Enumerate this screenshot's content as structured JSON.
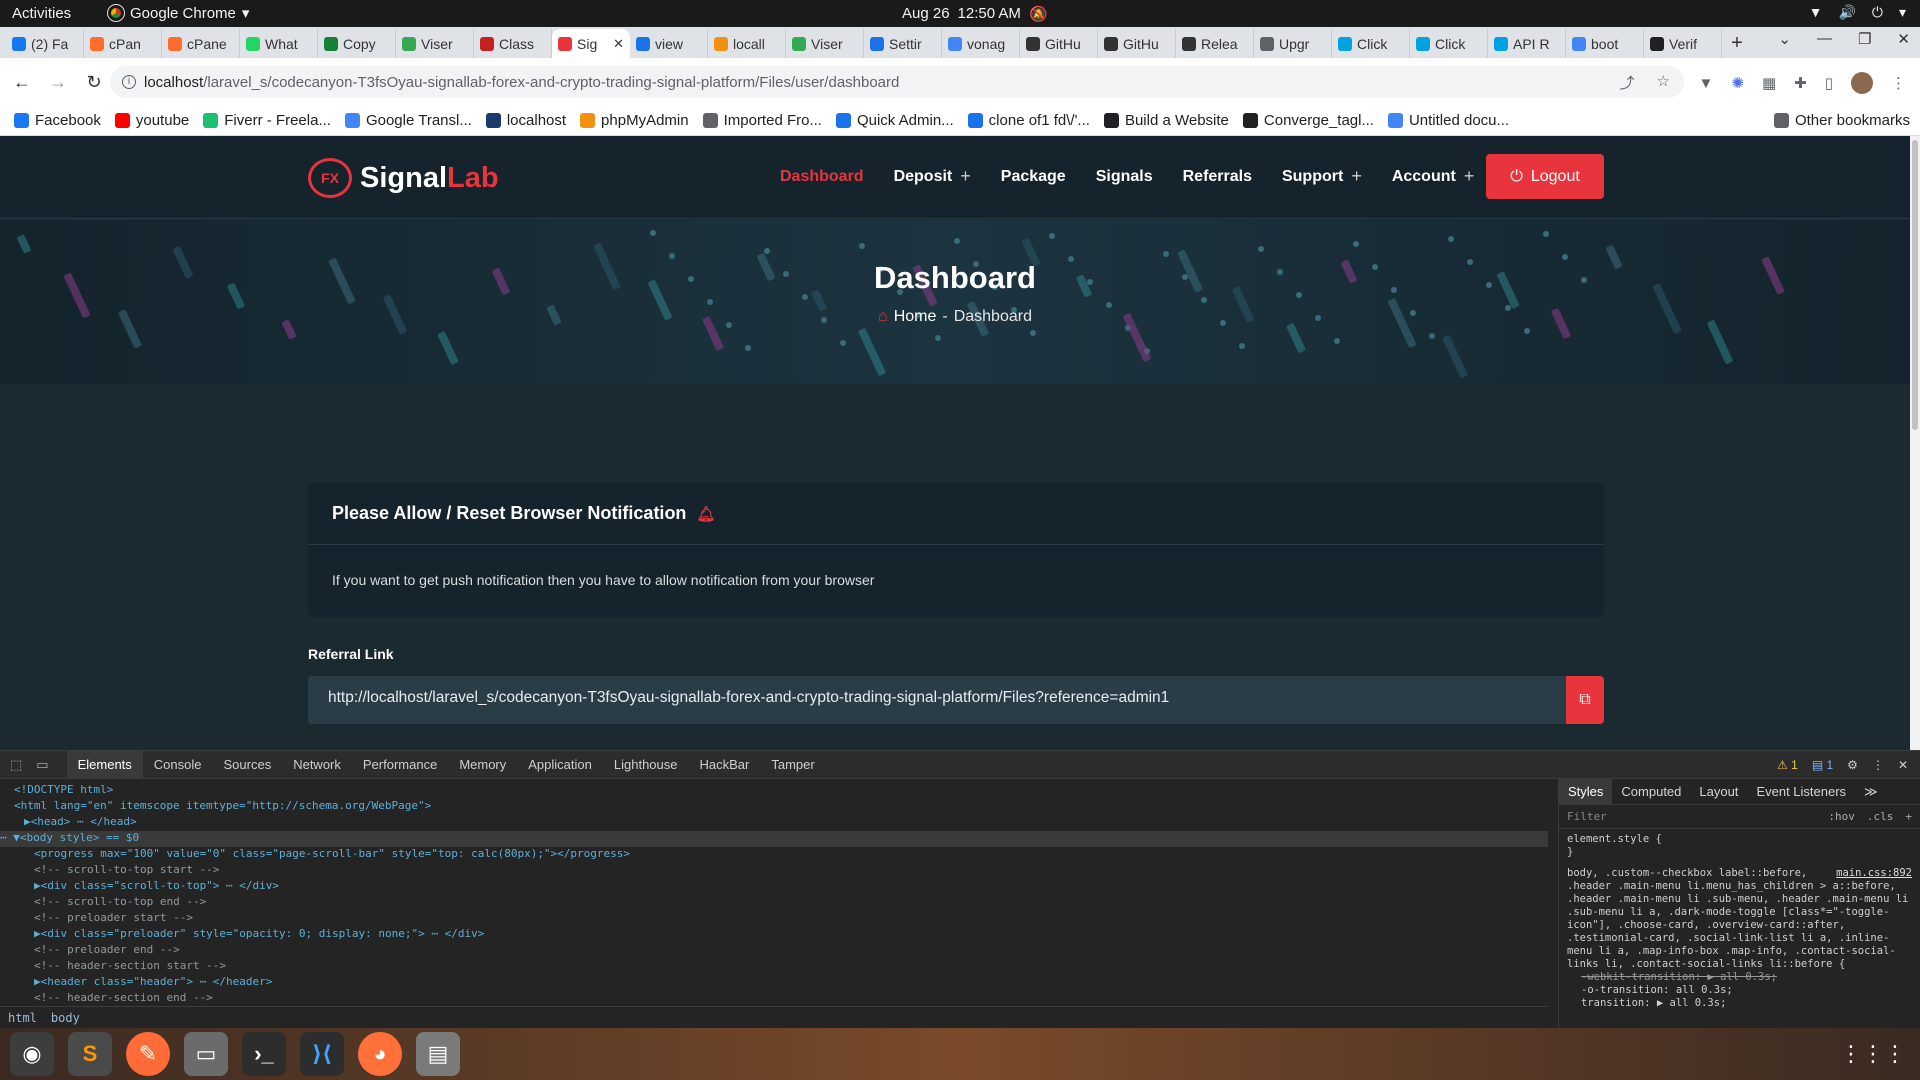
{
  "os": {
    "activities": "Activities",
    "app_name": "Google Chrome",
    "date": "Aug 26",
    "time": "12:50 AM"
  },
  "browser": {
    "tabs": [
      {
        "label": "(2) Fa",
        "color": "#1877f2"
      },
      {
        "label": "cPan",
        "color": "#ff6c2c"
      },
      {
        "label": "cPane",
        "color": "#ff6c2c"
      },
      {
        "label": "What",
        "color": "#25d366"
      },
      {
        "label": "Copy",
        "color": "#188038"
      },
      {
        "label": "Viser",
        "color": "#34a853"
      },
      {
        "label": "Class",
        "color": "#c5221f"
      },
      {
        "label": "Sig",
        "color": "#e8343d",
        "active": true
      },
      {
        "label": "view",
        "color": "#1a73e8"
      },
      {
        "label": "locall",
        "color": "#f29111"
      },
      {
        "label": "Viser",
        "color": "#34a853"
      },
      {
        "label": "Settir",
        "color": "#1a73e8"
      },
      {
        "label": "vonag",
        "color": "#4285f4"
      },
      {
        "label": "GitHu",
        "color": "#333333"
      },
      {
        "label": "GitHu",
        "color": "#333333"
      },
      {
        "label": "Relea",
        "color": "#333333"
      },
      {
        "label": "Upgr",
        "color": "#5f6368"
      },
      {
        "label": "Click",
        "color": "#00a1e0"
      },
      {
        "label": "Click",
        "color": "#00a1e0"
      },
      {
        "label": "API R",
        "color": "#00a1e0"
      },
      {
        "label": "boot",
        "color": "#4285f4"
      },
      {
        "label": "Verif",
        "color": "#202124"
      }
    ],
    "url_host": "localhost",
    "url_path": "/laravel_s/codecanyon-T3fsOyau-signallab-forex-and-crypto-trading-signal-platform/Files/user/dashboard",
    "bookmarks": [
      {
        "label": "Facebook",
        "color": "#1877f2"
      },
      {
        "label": "youtube",
        "color": "#ff0000"
      },
      {
        "label": "Fiverr - Freela...",
        "color": "#1dbf73"
      },
      {
        "label": "Google Transl...",
        "color": "#4285f4"
      },
      {
        "label": "localhost",
        "color": "#1a3a6b"
      },
      {
        "label": "phpMyAdmin",
        "color": "#f29111"
      },
      {
        "label": "Imported Fro...",
        "color": "#5f6368"
      },
      {
        "label": "Quick Admin...",
        "color": "#1a73e8"
      },
      {
        "label": "clone of1 fd\\/'...",
        "color": "#1a73e8"
      },
      {
        "label": "Build a Website",
        "color": "#202124"
      },
      {
        "label": "Converge_tagl...",
        "color": "#202124"
      },
      {
        "label": "Untitled docu...",
        "color": "#4285f4"
      }
    ],
    "other_bookmarks": "Other bookmarks"
  },
  "site": {
    "logo_fx": "FX",
    "logo_signal": "Signal",
    "logo_lab": "Lab",
    "nav": [
      {
        "label": "Dashboard",
        "active": true,
        "plus": false
      },
      {
        "label": "Deposit",
        "active": false,
        "plus": true
      },
      {
        "label": "Package",
        "active": false,
        "plus": false
      },
      {
        "label": "Signals",
        "active": false,
        "plus": false
      },
      {
        "label": "Referrals",
        "active": false,
        "plus": false
      },
      {
        "label": "Support",
        "active": false,
        "plus": true
      },
      {
        "label": "Account",
        "active": false,
        "plus": true
      }
    ],
    "logout": "Logout",
    "page_title": "Dashboard",
    "breadcrumb_home": "Home",
    "breadcrumb_sep": "-",
    "breadcrumb_current": "Dashboard",
    "notice_title": "Please Allow / Reset Browser Notification",
    "notice_body": "If you want to get push notification then you have to allow notification from your browser",
    "referral_label": "Referral Link",
    "referral_url": "http://localhost/laravel_s/codecanyon-T3fsOyau-signallab-forex-and-crypto-trading-signal-platform/Files?reference=admin1",
    "accent": "#e8343d"
  },
  "devtools": {
    "tabs": [
      "Elements",
      "Console",
      "Sources",
      "Network",
      "Performance",
      "Memory",
      "Application",
      "Lighthouse",
      "HackBar",
      "Tamper"
    ],
    "warnings": "1",
    "messages": "1",
    "dom_lines": [
      "<!DOCTYPE html>",
      "<html lang=\"en\" itemscope itemtype=\"http://schema.org/WebPage\">",
      "▶<head> ⋯ </head>",
      "⋯ ▼<body style> == $0",
      "<progress max=\"100\" value=\"0\" class=\"page-scroll-bar\" style=\"top: calc(80px);\"></progress>",
      "<!-- scroll-to-top start -->",
      "▶<div class=\"scroll-to-top\"> ⋯ </div>",
      "<!-- scroll-to-top end -->",
      "<!-- preloader start -->",
      "▶<div class=\"preloader\" style=\"opacity: 0; display: none;\"> ⋯ </div>",
      "<!-- preloader end -->",
      "<!-- header-section start  -->",
      "▶<header class=\"header\"> ⋯ </header>",
      "<!-- header-section end  -->"
    ],
    "side_tabs": [
      "Styles",
      "Computed",
      "Layout",
      "Event Listeners",
      "≫"
    ],
    "filter_placeholder": "Filter",
    "hov": ":hov",
    "cls": ".cls",
    "element_style_open": "element.style {",
    "element_style_close": "}",
    "rule_selector": "body, .custom--checkbox label::before, .header .main-menu li.menu_has_children > a::before, .header .main-menu li .sub-menu, .header .main-menu li .sub-menu li a, .dark-mode-toggle [class*=\"-toggle-icon\"], .choose-card, .overview-card::after, .testimonial-card, .social-link-list li a, .inline-menu li a, .map-info-box .map-info, .contact-social-links li, .contact-social-links li::before {",
    "rule_source": "main.css:892",
    "prop1": "-webkit-transition: ▶ all 0.3s;",
    "prop2": "-o-transition: all 0.3s;",
    "prop3": "transition: ▶ all 0.3s;",
    "crumbs": [
      "html",
      "body"
    ]
  }
}
